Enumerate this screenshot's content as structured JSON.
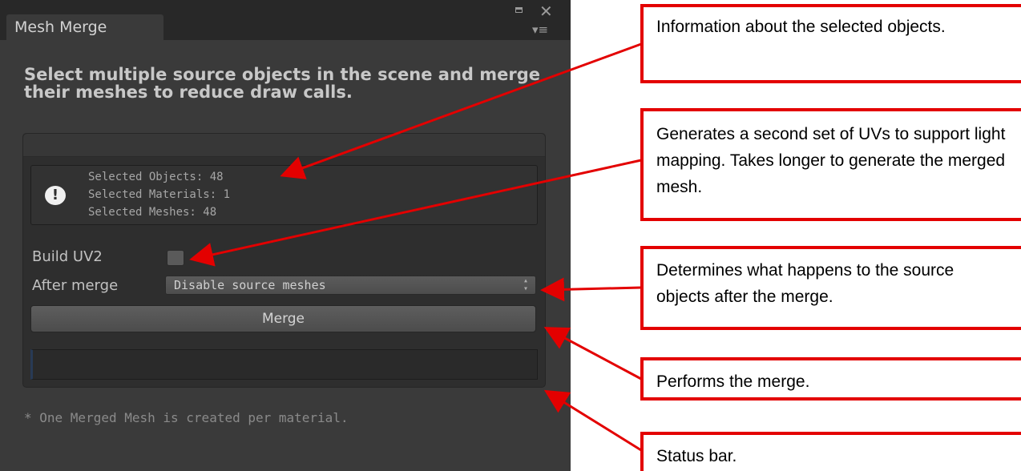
{
  "window": {
    "tab_title": "Mesh Merge"
  },
  "heading": "Select multiple source objects in the scene and merge their meshes to reduce draw calls.",
  "info": {
    "lines": [
      "Selected Objects: 48",
      "Selected Materials: 1",
      "Selected Meshes: 48"
    ]
  },
  "build_uv2": {
    "label": "Build UV2",
    "checked": false
  },
  "after_merge": {
    "label": "After merge",
    "selected": "Disable source meshes"
  },
  "merge_button": "Merge",
  "footnote": "* One Merged Mesh is created per material.",
  "callouts": [
    "Information about the selected objects.",
    "Generates a second set of UVs to support light mapping. Takes longer to generate the merged mesh.",
    "Determines what happens to the source objects after the merge.",
    "Performs the merge.",
    "Status bar."
  ],
  "colors": {
    "panel_bg": "#3a3a3a",
    "callout_border": "#e30000",
    "arrow": "#e30000"
  }
}
